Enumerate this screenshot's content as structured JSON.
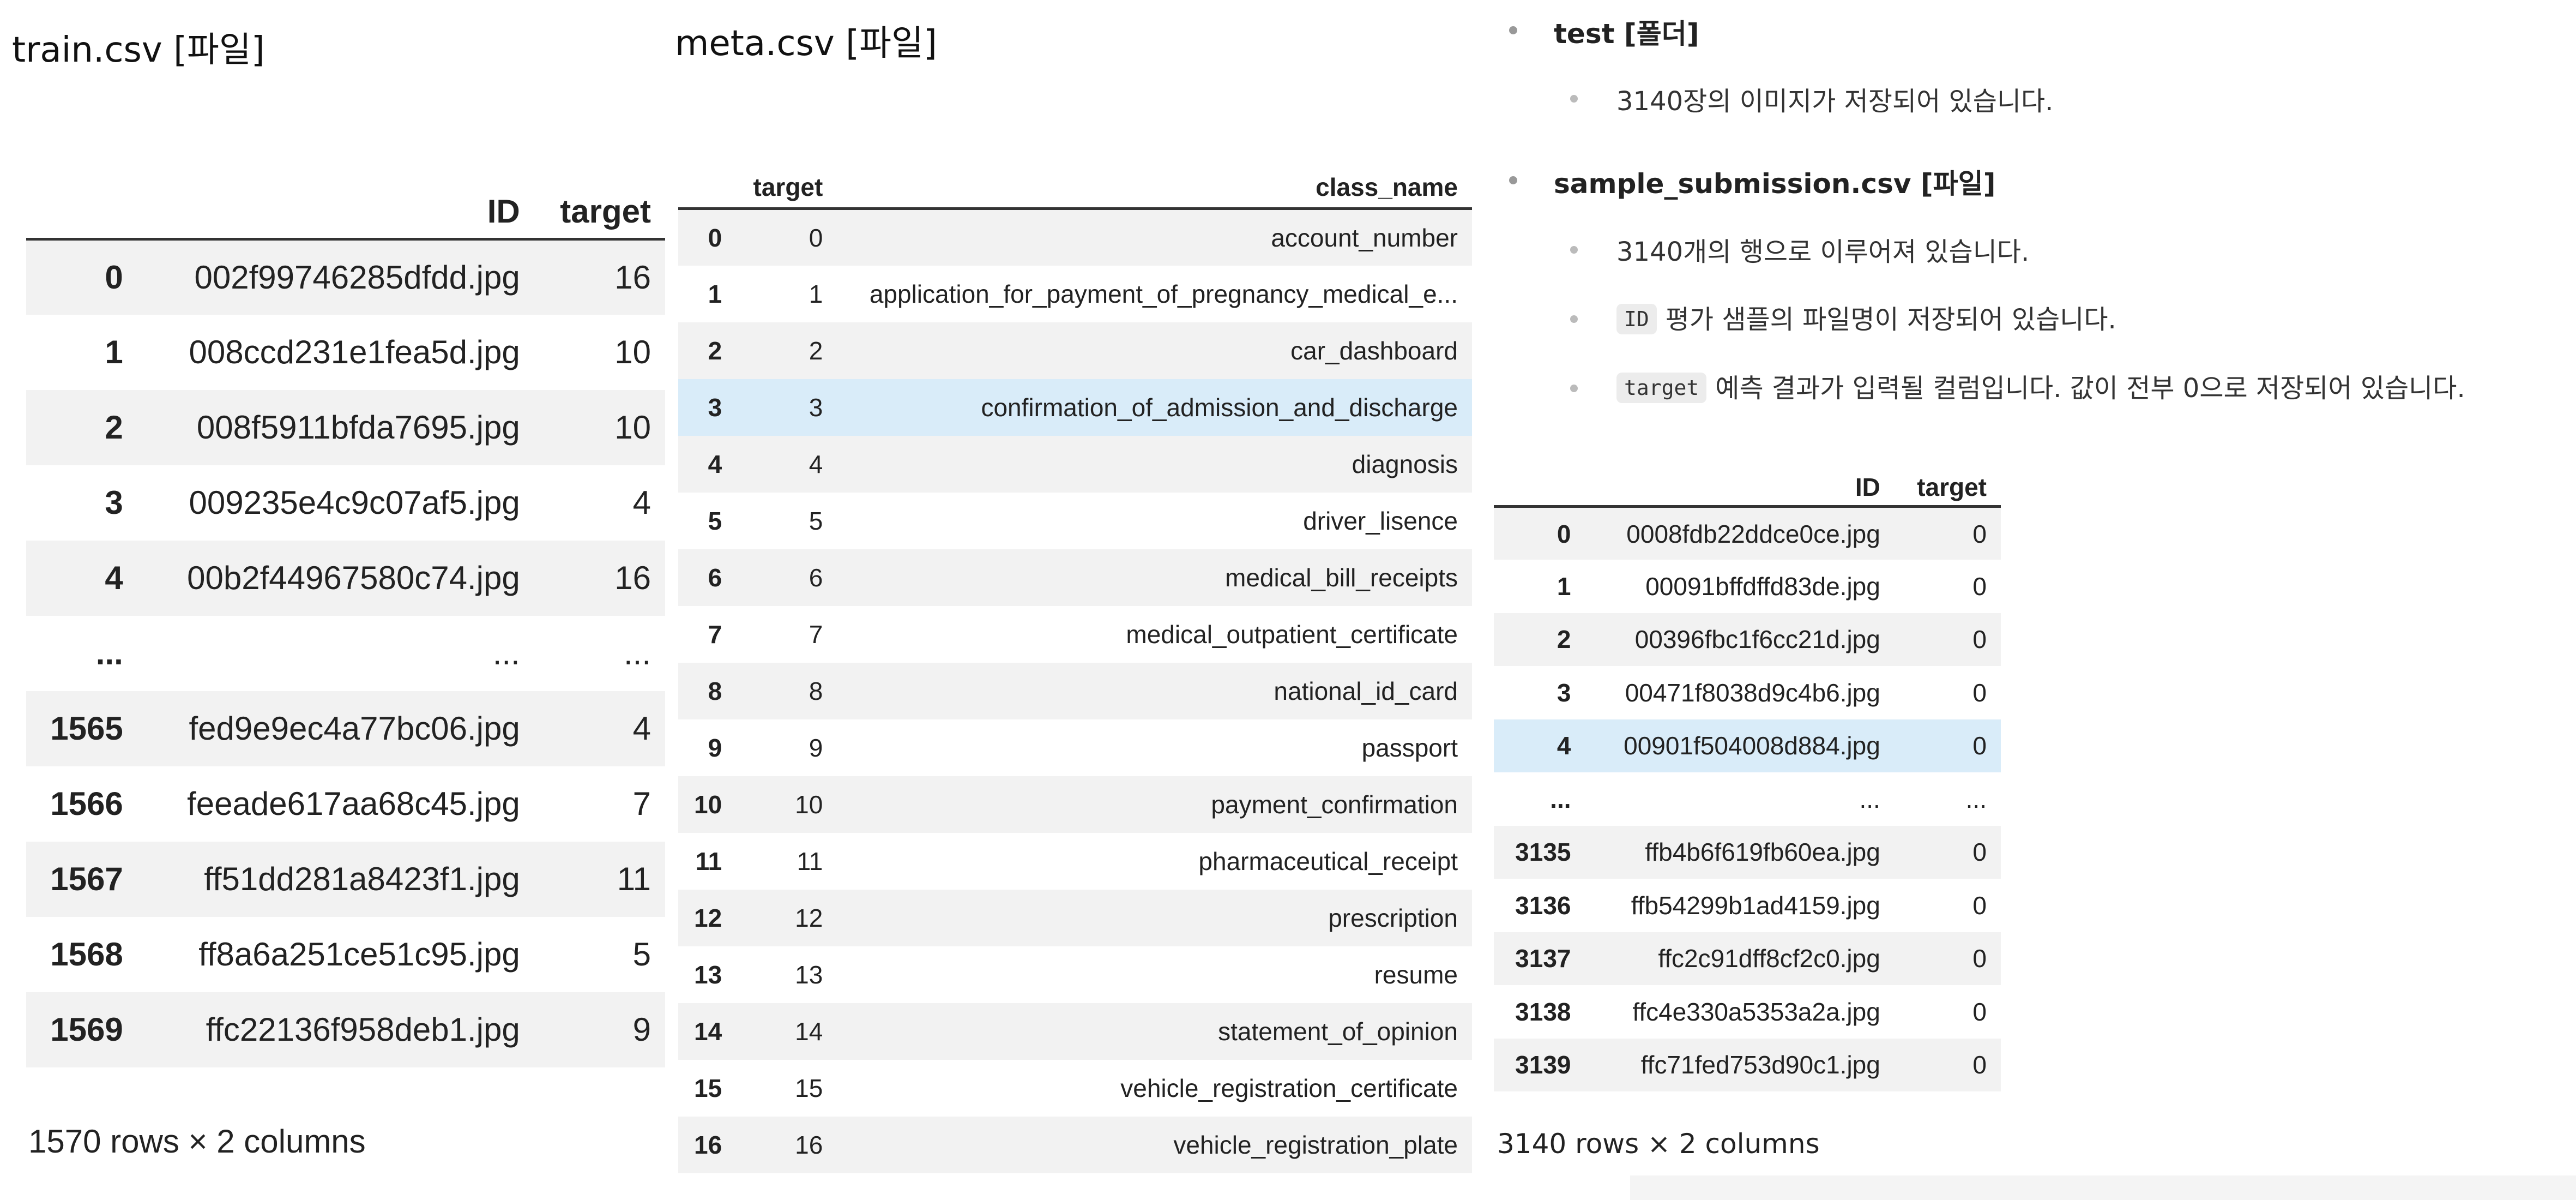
{
  "train": {
    "heading": "train.csv [파일]",
    "columns": [
      "",
      "ID",
      "target"
    ],
    "rows": [
      [
        "0",
        "002f99746285dfdd.jpg",
        "16"
      ],
      [
        "1",
        "008ccd231e1fea5d.jpg",
        "10"
      ],
      [
        "2",
        "008f5911bfda7695.jpg",
        "10"
      ],
      [
        "3",
        "009235e4c9c07af5.jpg",
        "4"
      ],
      [
        "4",
        "00b2f44967580c74.jpg",
        "16"
      ],
      [
        "...",
        "...",
        "..."
      ],
      [
        "1565",
        "fed9e9ec4a77bc06.jpg",
        "4"
      ],
      [
        "1566",
        "feeade617aa68c45.jpg",
        "7"
      ],
      [
        "1567",
        "ff51dd281a8423f1.jpg",
        "11"
      ],
      [
        "1568",
        "ff8a6a251ce51c95.jpg",
        "5"
      ],
      [
        "1569",
        "ffc22136f958deb1.jpg",
        "9"
      ]
    ],
    "footer": "1570 rows × 2 columns"
  },
  "meta": {
    "heading": "meta.csv [파일]",
    "columns": [
      "",
      "target",
      "class_name"
    ],
    "highlight_row": 3,
    "rows": [
      [
        "0",
        "0",
        "account_number"
      ],
      [
        "1",
        "1",
        "application_for_payment_of_pregnancy_medical_e..."
      ],
      [
        "2",
        "2",
        "car_dashboard"
      ],
      [
        "3",
        "3",
        "confirmation_of_admission_and_discharge"
      ],
      [
        "4",
        "4",
        "diagnosis"
      ],
      [
        "5",
        "5",
        "driver_lisence"
      ],
      [
        "6",
        "6",
        "medical_bill_receipts"
      ],
      [
        "7",
        "7",
        "medical_outpatient_certificate"
      ],
      [
        "8",
        "8",
        "national_id_card"
      ],
      [
        "9",
        "9",
        "passport"
      ],
      [
        "10",
        "10",
        "payment_confirmation"
      ],
      [
        "11",
        "11",
        "pharmaceutical_receipt"
      ],
      [
        "12",
        "12",
        "prescription"
      ],
      [
        "13",
        "13",
        "resume"
      ],
      [
        "14",
        "14",
        "statement_of_opinion"
      ],
      [
        "15",
        "15",
        "vehicle_registration_certificate"
      ],
      [
        "16",
        "16",
        "vehicle_registration_plate"
      ]
    ]
  },
  "notes": {
    "test_folder": "test [폴더]",
    "test_desc": "3140장의 이미지가 저장되어 있습니다.",
    "submission_file": "sample_submission.csv [파일]",
    "submission_rows_desc": "3140개의 행으로 이루어져 있습니다.",
    "id_code": "ID",
    "id_desc": "평가 샘플의 파일명이 저장되어 있습니다.",
    "target_code": "target",
    "target_desc": "예측 결과가 입력될 컬럼입니다. 값이 전부 0으로 저장되어 있습니다."
  },
  "submission": {
    "columns": [
      "",
      "ID",
      "target"
    ],
    "highlight_row": 4,
    "rows": [
      [
        "0",
        "0008fdb22ddce0ce.jpg",
        "0"
      ],
      [
        "1",
        "00091bffdffd83de.jpg",
        "0"
      ],
      [
        "2",
        "00396fbc1f6cc21d.jpg",
        "0"
      ],
      [
        "3",
        "00471f8038d9c4b6.jpg",
        "0"
      ],
      [
        "4",
        "00901f504008d884.jpg",
        "0"
      ],
      [
        "...",
        "...",
        "..."
      ],
      [
        "3135",
        "ffb4b6f619fb60ea.jpg",
        "0"
      ],
      [
        "3136",
        "ffb54299b1ad4159.jpg",
        "0"
      ],
      [
        "3137",
        "ffc2c91dff8cf2c0.jpg",
        "0"
      ],
      [
        "3138",
        "ffc4e330a5353a2a.jpg",
        "0"
      ],
      [
        "3139",
        "ffc71fed753d90c1.jpg",
        "0"
      ]
    ],
    "footer": "3140 rows × 2 columns"
  }
}
